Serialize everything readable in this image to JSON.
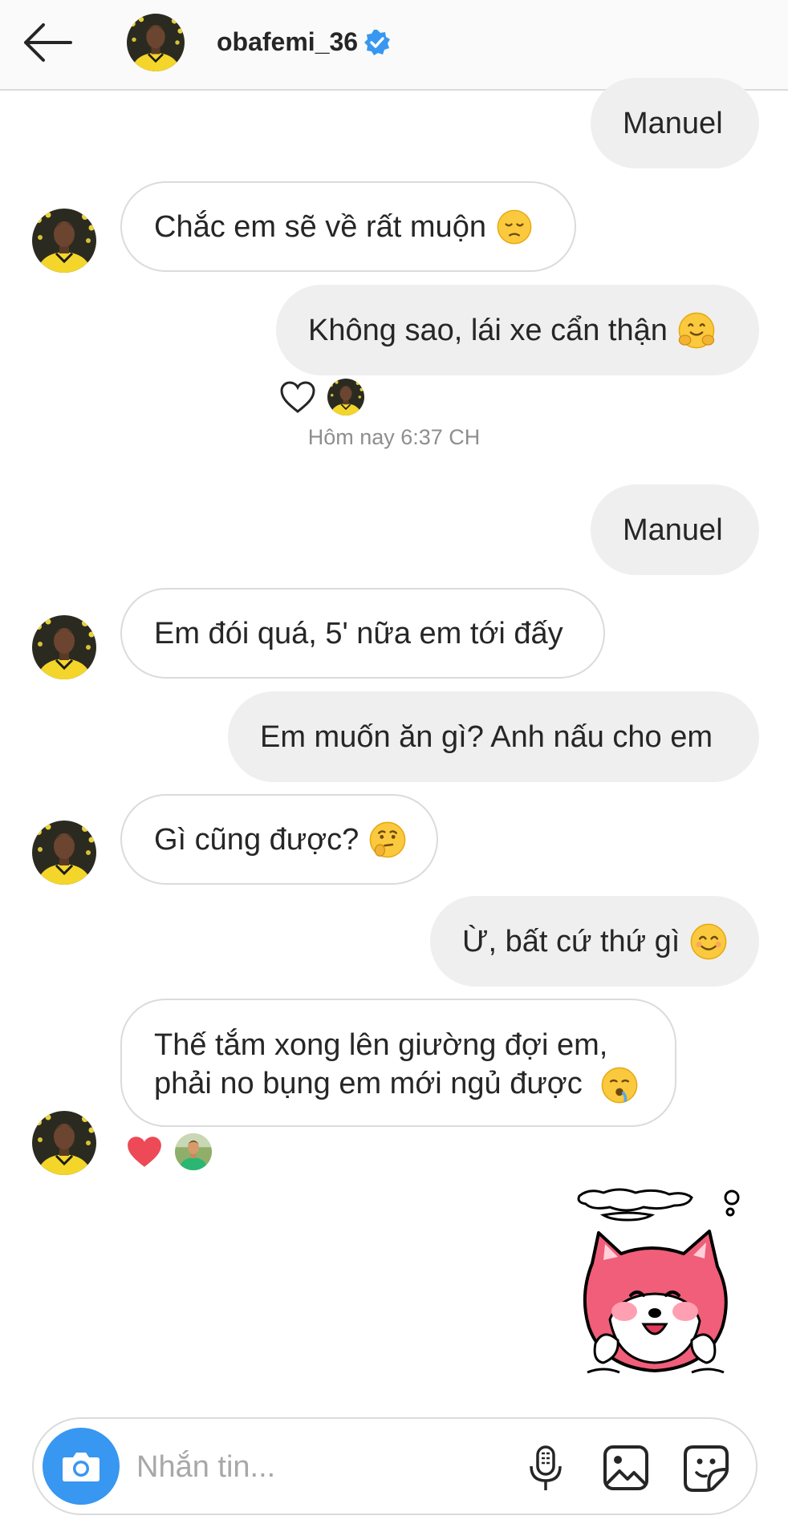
{
  "header": {
    "username": "obafemi_36",
    "verified": true,
    "back_icon": "arrow-left-icon",
    "verified_icon": "verified-badge-icon"
  },
  "messages": [
    {
      "side": "me",
      "text": "Manuel"
    },
    {
      "side": "them",
      "text": "Chắc em sẽ về rất muộn",
      "emoji": "pensive-face"
    },
    {
      "side": "me",
      "text": "Không sao, lái xe cẩn thận",
      "emoji": "hugging-face",
      "reaction": "heart-outline-icon"
    },
    {
      "side": "me",
      "text": "Manuel"
    },
    {
      "side": "them",
      "text": "Em đói quá, 5' nữa em tới đấy"
    },
    {
      "side": "me",
      "text": "Em muốn ăn gì? Anh nấu cho em"
    },
    {
      "side": "them",
      "text": "Gì cũng được?",
      "emoji": "thinking-face"
    },
    {
      "side": "me",
      "text": "Ừ, bất cứ thứ gì",
      "emoji": "smiling-face"
    },
    {
      "side": "them",
      "line1": "Thế tắm xong lên giường đợi em,",
      "line2": "phải no bụng em mới ngủ được",
      "emoji": "drooling-face",
      "reaction": "heart-filled-icon"
    },
    {
      "side": "me",
      "sticker": "pink-fox-sticker"
    }
  ],
  "timestamp": "Hôm nay 6:37 CH",
  "composer": {
    "placeholder": "Nhắn tin...",
    "camera_icon": "camera-icon",
    "mic_icon": "microphone-icon",
    "gallery_icon": "image-gallery-icon",
    "sticker_icon": "sticker-icon"
  },
  "colors": {
    "accent_blue": "#3897f0",
    "reaction_red": "#ed4956",
    "my_bubble": "#efefef",
    "their_bubble_border": "#dbdbdb",
    "timestamp_gray": "#8e8e8e"
  }
}
